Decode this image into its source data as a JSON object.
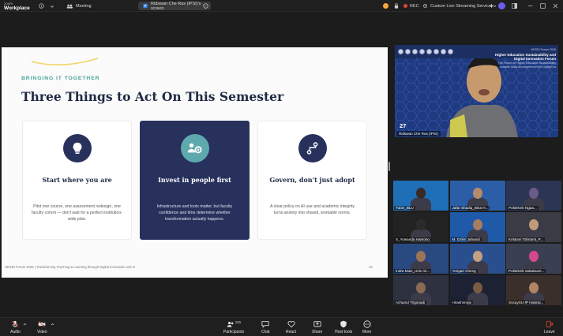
{
  "topbar": {
    "brand_small": "zoom",
    "brand_big": "Workplace",
    "tab_meeting": "Meeting",
    "tab_share": "Ridswan Che Rus (IPSI)'s screen",
    "rec_label": "REC",
    "stream_label": "Custom Live Streaming Service"
  },
  "slide": {
    "eyebrow": "BRINGING IT TOGETHER",
    "title": "Three Things to Act On This Semester",
    "cards": [
      {
        "icon": "lightbulb-icon",
        "title": "Start where you are",
        "body": "Pilot one course, one assessment redesign, one faculty cohort — don't wait for a perfect institution-wide plan."
      },
      {
        "icon": "people-gear-icon",
        "title": "Invest in people first",
        "body": "Infrastructure and tools matter, but faculty confidence and time determine whether transformation actually happens."
      },
      {
        "icon": "route-icon",
        "title": "Govern, don't just adopt",
        "body": "A clear policy on AI use and academic integrity turns anxiety into shared, workable norms."
      }
    ],
    "footer": "HESDI Forum 2026  |  Transforming Teaching & Learning through Digital Innovation and AI",
    "page": "16"
  },
  "speaker": {
    "forum_small": "HESDI Forum 2026",
    "forum_title_1": "Higher Education Sustainability and",
    "forum_title_2": "Digital Innovation Forum",
    "forum_sub_1": "The Forum on Higher Education Sustainability",
    "forum_sub_2": "towards Skills development in the Digital Era",
    "day": "27",
    "name": "Ridswan Che Rus (IPSI)"
  },
  "gallery": [
    {
      "name": "Tubin_BLU"
    },
    {
      "name": "Jafar Shadiq_Bina H..."
    },
    {
      "name": "Politeknik Ngaa..."
    },
    {
      "name": "S_Yowanda Harsono"
    },
    {
      "name": "M. Dzikri Jahandi"
    },
    {
      "name": "Kristiani Tobrianti_P..."
    },
    {
      "name": "Indra Muis_Univ Air..."
    },
    {
      "name": "Yongari Cheng"
    },
    {
      "name": "Politeknik Sakabumi..."
    },
    {
      "name": "Achamd Trigonadi"
    },
    {
      "name": "Hirashimiya"
    },
    {
      "name": "SocaySU-IP Hasirai..."
    }
  ],
  "bottombar": {
    "audio": "Audio",
    "video": "Video",
    "participants": "Participants",
    "participant_count": "131",
    "chat": "Chat",
    "react": "React",
    "share": "Share",
    "host_tools": "Host tools",
    "more": "More",
    "leave": "Leave"
  },
  "colors": {
    "navy": "#27315c",
    "teal": "#5ea9ad",
    "rec": "#e0443a",
    "leave": "#e0443a"
  }
}
